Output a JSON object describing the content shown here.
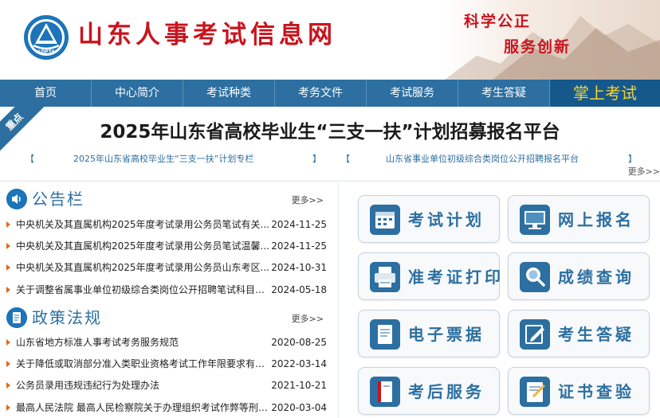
{
  "header": {
    "site_title": "山东人事考试信息网",
    "logo_text": "SDPTA",
    "slogan_line1": "科学公正",
    "slogan_line2": "服务创新"
  },
  "nav": {
    "items": [
      "首页",
      "中心简介",
      "考试种类",
      "考务文件",
      "考试服务",
      "考生答疑"
    ],
    "highlight": "掌上考试"
  },
  "banner": {
    "ribbon": "重点",
    "headline": "2025年山东省高校毕业生“三支一扶”计划招募报名平台",
    "link1": "2025年山东省高校毕业生“三支一扶”计划专栏",
    "link2": "山东省事业单位初级综合类岗位公开招聘报名平台",
    "bracket_open": "【",
    "bracket_close": "】",
    "more": "更多>>"
  },
  "notices": {
    "title": "公告栏",
    "more": "更多>>",
    "items": [
      {
        "text": "中央机关及其直属机构2025年度考试录用公务员笔试有关...",
        "date": "2024-11-25"
      },
      {
        "text": "中央机关及其直属机构2025年度考试录用公务员笔试温馨...",
        "date": "2024-11-25"
      },
      {
        "text": "中央机关及其直属机构2025年度考试录用公务员山东考区...",
        "date": "2024-10-31"
      },
      {
        "text": "关于调整省属事业单位初级综合类岗位公开招聘笔试科目的...",
        "date": "2024-05-18"
      }
    ]
  },
  "policies": {
    "title": "政策法规",
    "more": "更多>>",
    "items": [
      {
        "text": "山东省地方标准人事考试考务服务规范",
        "date": "2020-08-25"
      },
      {
        "text": "关于降低或取消部分准入类职业资格考试工作年限要求有关...",
        "date": "2022-03-14"
      },
      {
        "text": "公务员录用违规违纪行为处理办法",
        "date": "2021-10-21"
      },
      {
        "text": "最高人民法院 最高人民检察院关于办理组织考试作弊等刑事...",
        "date": "2020-03-04"
      }
    ]
  },
  "services": [
    {
      "label": "考试计划",
      "icon": "calendar-icon"
    },
    {
      "label": "网上报名",
      "icon": "monitor-icon"
    },
    {
      "label": "准考证打印",
      "icon": "printer-icon"
    },
    {
      "label": "成绩查询",
      "icon": "magnifier-icon"
    },
    {
      "label": "电子票据",
      "icon": "receipt-icon"
    },
    {
      "label": "考生答疑",
      "icon": "edit-icon"
    },
    {
      "label": "考后服务",
      "icon": "book-icon"
    },
    {
      "label": "证书查验",
      "icon": "certificate-icon"
    }
  ],
  "colors": {
    "brand_red": "#c8141e",
    "nav_blue": "#2c6fa0",
    "nav_highlight_text": "#f4d330",
    "bullet_orange": "#e06a1a"
  }
}
